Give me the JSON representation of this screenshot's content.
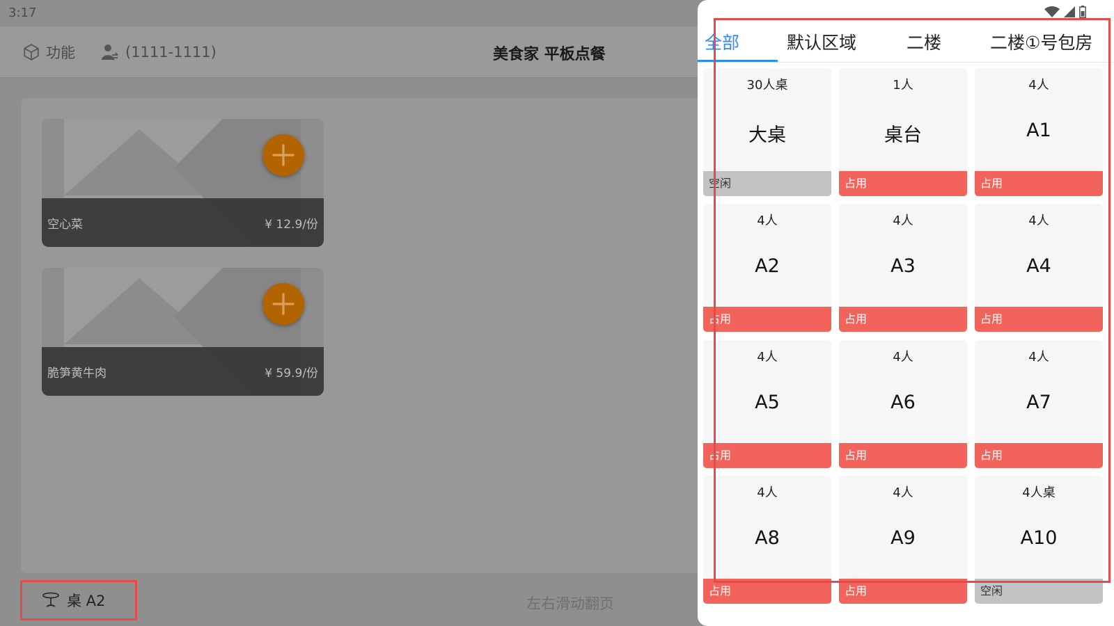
{
  "status_bar": {
    "time": "3:17"
  },
  "header": {
    "function_label": "功能",
    "user_label": "(1111-1111)",
    "title": "美食家 平板点餐"
  },
  "dishes": [
    {
      "name": "空心菜",
      "price": "¥ 12.9/份"
    },
    {
      "name": "脆笋黄牛肉",
      "price": "¥ 59.9/份"
    }
  ],
  "bottom_bar": {
    "table_label": "桌 A2",
    "swipe_hint": "左右滑动翻页"
  },
  "tabs": [
    {
      "label": "全部",
      "active": true
    },
    {
      "label": "默认区域",
      "active": false
    },
    {
      "label": "二楼",
      "active": false
    },
    {
      "label": "二楼①号包房",
      "active": false
    }
  ],
  "tables": [
    {
      "seats": "30人桌",
      "name": "大桌",
      "status": "空闲",
      "free": true
    },
    {
      "seats": "1人",
      "name": "桌台",
      "status": "占用",
      "free": false
    },
    {
      "seats": "4人",
      "name": "A1",
      "status": "占用",
      "free": false
    },
    {
      "seats": "4人",
      "name": "A2",
      "status": "占用",
      "free": false
    },
    {
      "seats": "4人",
      "name": "A3",
      "status": "占用",
      "free": false
    },
    {
      "seats": "4人",
      "name": "A4",
      "status": "占用",
      "free": false
    },
    {
      "seats": "4人",
      "name": "A5",
      "status": "占用",
      "free": false
    },
    {
      "seats": "4人",
      "name": "A6",
      "status": "占用",
      "free": false
    },
    {
      "seats": "4人",
      "name": "A7",
      "status": "占用",
      "free": false
    },
    {
      "seats": "4人",
      "name": "A8",
      "status": "占用",
      "free": false
    },
    {
      "seats": "4人",
      "name": "A9",
      "status": "占用",
      "free": false
    },
    {
      "seats": "4人桌",
      "name": "A10",
      "status": "空闲",
      "free": true
    }
  ],
  "colors": {
    "accent": "#2f8cf5",
    "occupied": "#f2635b",
    "free": "#c2c2c2",
    "add_button": "#b26400",
    "highlight": "#e84a4a"
  },
  "icons": {
    "function": "cube-icon",
    "user": "user-switch-icon",
    "table": "table-icon",
    "add": "plus-icon",
    "wifi": "wifi-icon",
    "signal": "signal-icon",
    "battery": "battery-icon"
  }
}
